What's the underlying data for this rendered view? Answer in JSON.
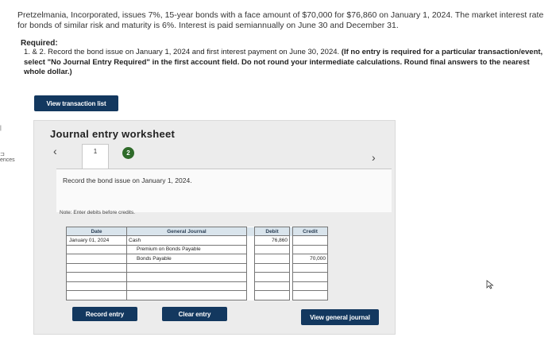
{
  "problem_text": "Pretzelmania, Incorporated, issues 7%, 15-year bonds with a face amount of $70,000 for $76,860 on January 1, 2024. The market interest rate for bonds of similar risk and maturity is 6%. Interest is paid semiannually on June 30 and December 31.",
  "required_heading": "Required:",
  "required_prefix": "1. & 2. Record the bond issue on January 1, 2024 and first interest payment on June 30, 2024.",
  "required_bold": "(If no entry is required for a particular transaction/event, select \"No Journal Entry Required\" in the first account field. Do not round your intermediate calculations. Round final answers to the nearest whole dollar.)",
  "left_edge_text": "ences",
  "view_transaction_list": "View transaction list",
  "worksheet_title": "Journal entry worksheet",
  "tabs": [
    "1",
    "2"
  ],
  "instruction": "Record the bond issue on January 1, 2024.",
  "note": "Note: Enter debits before credits.",
  "columns": {
    "date": "Date",
    "journal": "General Journal",
    "debit": "Debit",
    "credit": "Credit"
  },
  "rows": [
    {
      "date": "January 01, 2024",
      "account": "Cash",
      "debit": "76,860",
      "credit": ""
    },
    {
      "date": "",
      "account": "Premium on Bonds Payable",
      "debit": "",
      "credit": ""
    },
    {
      "date": "",
      "account": "Bonds Payable",
      "debit": "",
      "credit": "70,000"
    },
    {
      "date": "",
      "account": "",
      "debit": "",
      "credit": ""
    },
    {
      "date": "",
      "account": "",
      "debit": "",
      "credit": ""
    },
    {
      "date": "",
      "account": "",
      "debit": "",
      "credit": ""
    },
    {
      "date": "",
      "account": "",
      "debit": "",
      "credit": ""
    }
  ],
  "buttons": {
    "record": "Record entry",
    "clear": "Clear entry",
    "view_general": "View general journal"
  }
}
